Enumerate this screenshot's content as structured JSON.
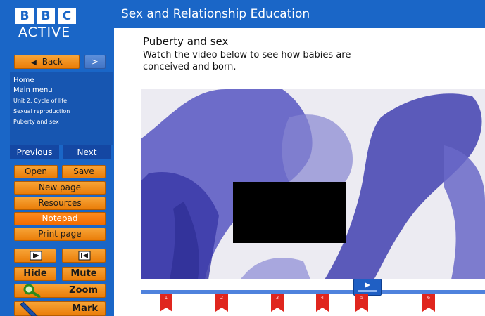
{
  "logo": {
    "letters": [
      "B",
      "B",
      "C"
    ],
    "subtitle": "ACTIVE"
  },
  "header": {
    "title": "Sex and Relationship Education"
  },
  "nav": {
    "back_label": "Back",
    "forward_symbol": ">"
  },
  "breadcrumbs": [
    "Home",
    "Main menu",
    "Unit 2: Cycle of life",
    "Sexual reproduction",
    "Puberty and sex"
  ],
  "pager": {
    "previous": "Previous",
    "next": "Next"
  },
  "buttons": {
    "open": "Open",
    "save": "Save",
    "new_page": "New page",
    "resources": "Resources",
    "notepad": "Notepad",
    "print_page": "Print page",
    "hide": "Hide",
    "mute": "Mute",
    "zoom": "Zoom",
    "mark": "Mark"
  },
  "lesson": {
    "title": "Puberty and sex",
    "instructions": "Watch the video below to see how babies are conceived and born."
  },
  "timeline": {
    "markers": [
      "1",
      "2",
      "3",
      "4",
      "5",
      "6"
    ]
  },
  "colors": {
    "brand_blue": "#1a66c7",
    "button_orange": "#f29418",
    "marker_red": "#e0261e"
  }
}
